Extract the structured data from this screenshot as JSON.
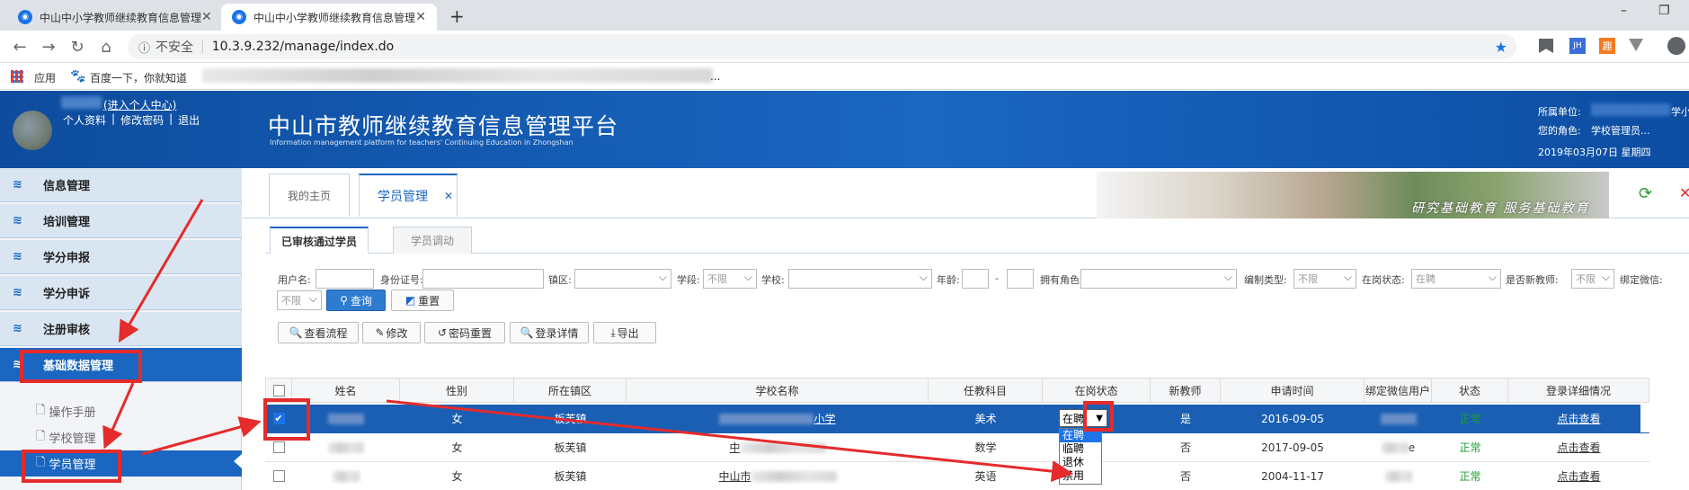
{
  "browser": {
    "tabs": [
      {
        "title": "中山中小学教师继续教育信息管理",
        "close": "✕"
      },
      {
        "title": "中山中小学教师继续教育信息管理",
        "close": "✕"
      }
    ],
    "new_tab": "+",
    "window_controls": {
      "minimize": "–",
      "restore": "❐"
    },
    "security_label": "不安全",
    "url": "10.3.9.232/manage/index.do",
    "bookmarks": [
      {
        "label": "应用"
      },
      {
        "label": "百度一下，你就知道"
      },
      {
        "label": "..."
      }
    ],
    "ext_labels": [
      "JH",
      "趣"
    ]
  },
  "header": {
    "user_center_link": "(进入个人中心)",
    "user_links": [
      "个人资料",
      "|",
      "修改密码",
      "|",
      "退出"
    ],
    "platform_title": "中山市教师继续教育信息管理平台",
    "platform_subtitle": "Information management platform for teachers' Continuing Education in Zhongshan",
    "unit_label": "所属单位:",
    "unit_suffix": "学小",
    "role_label": "您的角色:",
    "role_value": "学校管理员...",
    "date": "2019年03月07日 星期四"
  },
  "sidebar": {
    "menu": [
      {
        "label": "信息管理"
      },
      {
        "label": "培训管理"
      },
      {
        "label": "学分申报"
      },
      {
        "label": "学分申诉"
      },
      {
        "label": "注册审核"
      },
      {
        "label": "基础数据管理"
      }
    ],
    "submenu": [
      {
        "label": "操作手册"
      },
      {
        "label": "学校管理"
      },
      {
        "label": "学员管理"
      }
    ]
  },
  "main": {
    "tabs": [
      {
        "label": "我的主页"
      },
      {
        "label": "学员管理",
        "close": "✕"
      }
    ],
    "banner_text": "研究基础教育  服务基础教育",
    "subtabs": [
      {
        "label": "已审核通过学员"
      },
      {
        "label": "学员调动"
      }
    ]
  },
  "filters": {
    "username_label": "用户名:",
    "idcard_label": "身份证号:",
    "town_label": "镇区:",
    "stage_label": "学段:",
    "stage_value": "不限",
    "school_label": "学校:",
    "age_label": "年龄:",
    "age_sep": "-",
    "role_label": "拥有角色:",
    "staff_type_label": "编制类型:",
    "staff_type_value": "不限",
    "post_status_label": "在岗状态:",
    "post_status_value": "在聘",
    "new_teacher_label": "是否新教师:",
    "new_teacher_value": "不限",
    "wechat_label": "绑定微信:",
    "wechat_value": "不限",
    "search_button": "查询",
    "reset_button": "重置",
    "actions": [
      {
        "label": "查看流程",
        "icon": "🔍"
      },
      {
        "label": "修改",
        "icon": "✎"
      },
      {
        "label": "密码重置",
        "icon": "↺"
      },
      {
        "label": "登录详情",
        "icon": "🔍"
      },
      {
        "label": "导出",
        "icon": "⤓"
      }
    ]
  },
  "table": {
    "headers": [
      "",
      "姓名",
      "性别",
      "所在镇区",
      "学校名称",
      "任教科目",
      "在岗状态",
      "新教师",
      "申请时间",
      "绑定微信用户",
      "状态",
      "登录详细情况"
    ],
    "rows": [
      {
        "checked": "✔",
        "name": "",
        "gender": "女",
        "town": "板芙镇",
        "school": "小学",
        "subject": "美术",
        "post_status": "在聘",
        "new_teacher": "是",
        "apply_time": "2016-09-05",
        "wechat": "",
        "status": "正常",
        "detail": "点击查看"
      },
      {
        "checked": "",
        "name": "",
        "gender": "女",
        "town": "板芙镇",
        "school": "中",
        "subject": "数学",
        "post_status": "",
        "new_teacher": "否",
        "apply_time": "2017-09-05",
        "wechat": "e",
        "status": "正常",
        "detail": "点击查看"
      },
      {
        "checked": "",
        "name": "",
        "gender": "女",
        "town": "板芙镇",
        "school": "中山市",
        "subject": "英语",
        "post_status": "",
        "new_teacher": "否",
        "apply_time": "2004-11-17",
        "wechat": "",
        "status": "正常",
        "detail": "点击查看"
      }
    ]
  },
  "post_status_dropdown": {
    "selected": "在聘",
    "options": [
      "在聘",
      "临聘",
      "退休",
      "禁用"
    ]
  },
  "colors": {
    "accent": "#1a66c1",
    "annotation_red": "#e52b2b",
    "status_ok": "#1e9e2e"
  }
}
